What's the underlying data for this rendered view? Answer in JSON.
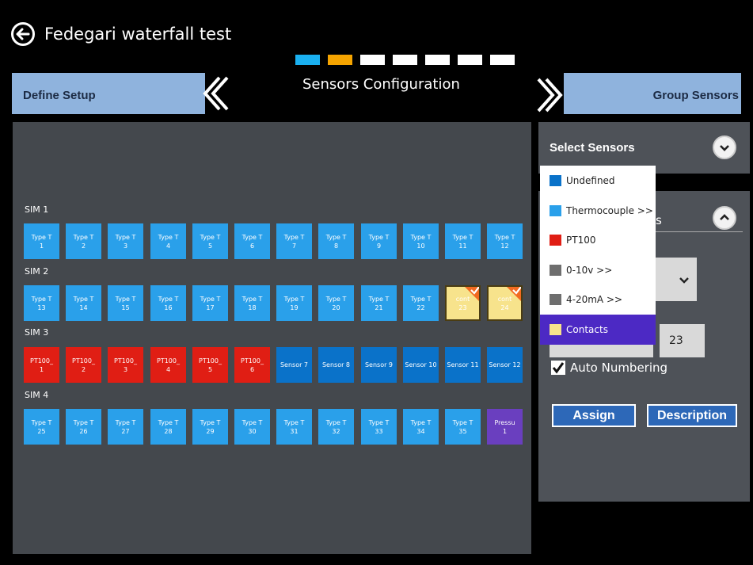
{
  "app": {
    "title": "Fedegari waterfall test"
  },
  "steps": [
    {
      "state": "done",
      "color": "#1ab0f0"
    },
    {
      "state": "current",
      "color": "#f5a400"
    },
    {
      "state": "todo",
      "color": "#ffffff"
    },
    {
      "state": "todo",
      "color": "#ffffff"
    },
    {
      "state": "todo",
      "color": "#ffffff"
    },
    {
      "state": "todo",
      "color": "#ffffff"
    },
    {
      "state": "todo",
      "color": "#ffffff"
    }
  ],
  "nav": {
    "prev_label": "Define Setup",
    "title": "Sensors Configuration",
    "next_label": "Group Sensors"
  },
  "colors": {
    "thermocouple": "#2aa0ea",
    "pt100": "#e01e14",
    "undefined": "#0a72c9",
    "contacts": "#f7e38c",
    "pressure": "#6a3fbf",
    "zero_ten_v": "#6e6e6e",
    "four_twenty_ma": "#6e6e6e",
    "panel": "#44484d",
    "header_bar": "#8fb3dd",
    "check_badge": "#f26a21",
    "selected_menu": "#4c29c4"
  },
  "sims": [
    {
      "label": "SIM 1",
      "sensors": [
        {
          "line1": "Type T",
          "line2": "1",
          "kind": "thermocouple"
        },
        {
          "line1": "Type T",
          "line2": "2",
          "kind": "thermocouple"
        },
        {
          "line1": "Type T",
          "line2": "3",
          "kind": "thermocouple"
        },
        {
          "line1": "Type T",
          "line2": "4",
          "kind": "thermocouple"
        },
        {
          "line1": "Type T",
          "line2": "5",
          "kind": "thermocouple"
        },
        {
          "line1": "Type T",
          "line2": "6",
          "kind": "thermocouple"
        },
        {
          "line1": "Type T",
          "line2": "7",
          "kind": "thermocouple"
        },
        {
          "line1": "Type T",
          "line2": "8",
          "kind": "thermocouple"
        },
        {
          "line1": "Type T",
          "line2": "9",
          "kind": "thermocouple"
        },
        {
          "line1": "Type T",
          "line2": "10",
          "kind": "thermocouple"
        },
        {
          "line1": "Type T",
          "line2": "11",
          "kind": "thermocouple"
        },
        {
          "line1": "Type T",
          "line2": "12",
          "kind": "thermocouple"
        }
      ]
    },
    {
      "label": "SIM 2",
      "sensors": [
        {
          "line1": "Type T",
          "line2": "13",
          "kind": "thermocouple"
        },
        {
          "line1": "Type T",
          "line2": "14",
          "kind": "thermocouple"
        },
        {
          "line1": "Type T",
          "line2": "15",
          "kind": "thermocouple"
        },
        {
          "line1": "Type T",
          "line2": "16",
          "kind": "thermocouple"
        },
        {
          "line1": "Type T",
          "line2": "17",
          "kind": "thermocouple"
        },
        {
          "line1": "Type T",
          "line2": "18",
          "kind": "thermocouple"
        },
        {
          "line1": "Type T",
          "line2": "19",
          "kind": "thermocouple"
        },
        {
          "line1": "Type T",
          "line2": "20",
          "kind": "thermocouple"
        },
        {
          "line1": "Type T",
          "line2": "21",
          "kind": "thermocouple"
        },
        {
          "line1": "Type T",
          "line2": "22",
          "kind": "thermocouple"
        },
        {
          "line1": "cont",
          "line2": "23",
          "kind": "contacts",
          "checked": true
        },
        {
          "line1": "cont",
          "line2": "24",
          "kind": "contacts",
          "checked": true
        }
      ]
    },
    {
      "label": "SIM 3",
      "sensors": [
        {
          "line1": "PT100_",
          "line2": "1",
          "kind": "pt100"
        },
        {
          "line1": "PT100_",
          "line2": "2",
          "kind": "pt100"
        },
        {
          "line1": "PT100_",
          "line2": "3",
          "kind": "pt100"
        },
        {
          "line1": "PT100_",
          "line2": "4",
          "kind": "pt100"
        },
        {
          "line1": "PT100_",
          "line2": "5",
          "kind": "pt100"
        },
        {
          "line1": "PT100_",
          "line2": "6",
          "kind": "pt100"
        },
        {
          "line1": "Sensor 7",
          "line2": "",
          "kind": "undefined"
        },
        {
          "line1": "Sensor 8",
          "line2": "",
          "kind": "undefined"
        },
        {
          "line1": "Sensor 9",
          "line2": "",
          "kind": "undefined"
        },
        {
          "line1": "Sensor 10",
          "line2": "",
          "kind": "undefined"
        },
        {
          "line1": "Sensor 11",
          "line2": "",
          "kind": "undefined"
        },
        {
          "line1": "Sensor 12",
          "line2": "",
          "kind": "undefined"
        }
      ]
    },
    {
      "label": "SIM 4",
      "sensors": [
        {
          "line1": "Type T",
          "line2": "25",
          "kind": "thermocouple"
        },
        {
          "line1": "Type T",
          "line2": "26",
          "kind": "thermocouple"
        },
        {
          "line1": "Type T",
          "line2": "27",
          "kind": "thermocouple"
        },
        {
          "line1": "Type T",
          "line2": "28",
          "kind": "thermocouple"
        },
        {
          "line1": "Type T",
          "line2": "29",
          "kind": "thermocouple"
        },
        {
          "line1": "Type T",
          "line2": "30",
          "kind": "thermocouple"
        },
        {
          "line1": "Type T",
          "line2": "31",
          "kind": "thermocouple"
        },
        {
          "line1": "Type T",
          "line2": "32",
          "kind": "thermocouple"
        },
        {
          "line1": "Type T",
          "line2": "33",
          "kind": "thermocouple"
        },
        {
          "line1": "Type T",
          "line2": "34",
          "kind": "thermocouple"
        },
        {
          "line1": "Type T",
          "line2": "35",
          "kind": "thermocouple"
        },
        {
          "line1": "Pressu",
          "line2": "1",
          "kind": "pressure"
        }
      ]
    }
  ],
  "side": {
    "select_sensors_label": "Select Sensors",
    "section2_fragment": "s",
    "number_value": "23",
    "auto_numbering_label": "Auto Numbering",
    "auto_numbering_checked": true,
    "assign_label": "Assign",
    "description_label": "Description"
  },
  "type_menu": {
    "items": [
      {
        "label": "Undefined",
        "kind": "undefined"
      },
      {
        "label": "Thermocouple >>",
        "kind": "thermocouple"
      },
      {
        "label": "PT100",
        "kind": "pt100"
      },
      {
        "label": "0-10v >>",
        "kind": "zero_ten_v"
      },
      {
        "label": "4-20mA >>",
        "kind": "four_twenty_ma"
      },
      {
        "label": "Contacts",
        "kind": "contacts",
        "selected": true
      }
    ]
  }
}
